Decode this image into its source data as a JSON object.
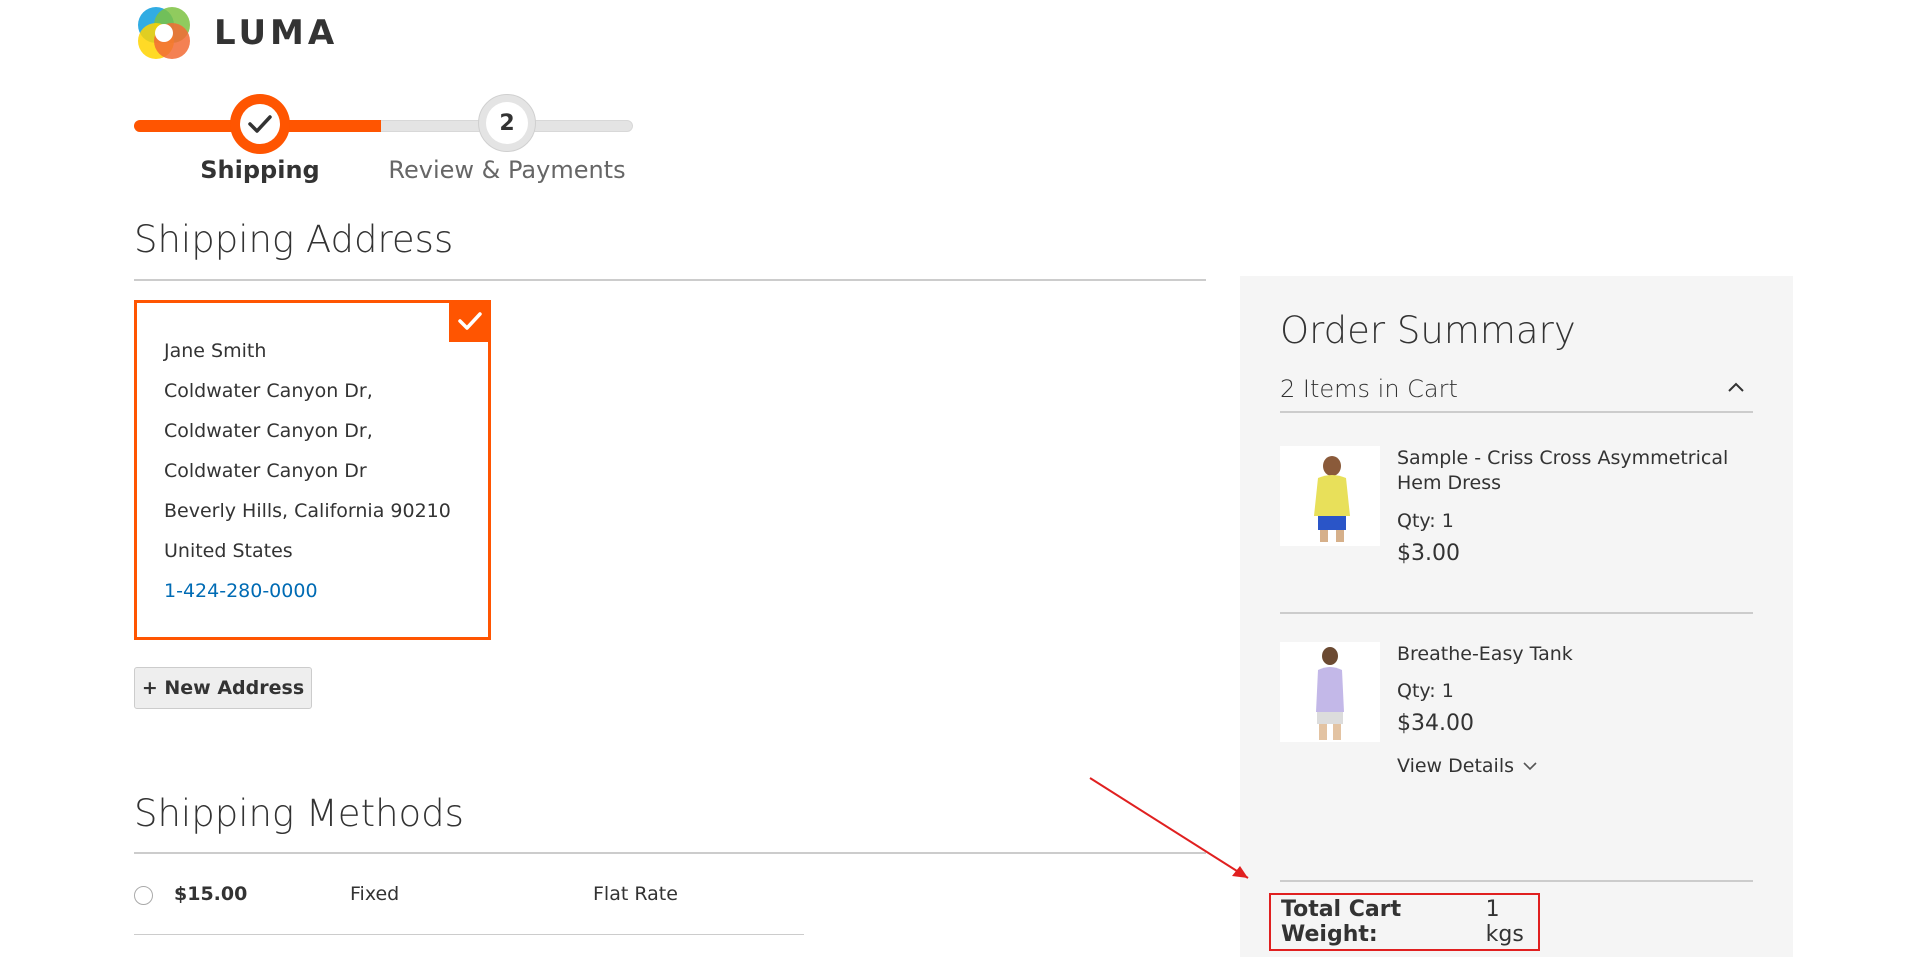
{
  "brand": {
    "name": "LUMA"
  },
  "progress": {
    "steps": [
      {
        "label": "Shipping",
        "state": "complete"
      },
      {
        "label": "Review & Payments",
        "number": "2",
        "state": "pending"
      }
    ]
  },
  "shipping_address": {
    "title": "Shipping Address",
    "selected_address": {
      "lines": [
        "Jane Smith",
        "Coldwater Canyon Dr,",
        "Coldwater Canyon Dr,",
        "Coldwater Canyon Dr",
        "Beverly Hills, California 90210",
        "United States"
      ],
      "phone": "1-424-280-0000"
    },
    "new_address_button": "+ New Address"
  },
  "shipping_methods": {
    "title": "Shipping Methods",
    "rows": [
      {
        "price": "$15.00",
        "type": "Fixed",
        "carrier": "Flat Rate"
      }
    ]
  },
  "order_summary": {
    "title": "Order Summary",
    "items_in_cart": "2 Items in Cart",
    "items": [
      {
        "name": "Sample - Criss Cross Asymmetrical Hem Dress",
        "qty": "Qty: 1",
        "price": "$3.00"
      },
      {
        "name": "Breathe-Easy Tank",
        "qty": "Qty: 1",
        "price": "$34.00",
        "view_details": "View Details"
      }
    ],
    "total_weight_label": "Total Cart Weight:",
    "total_weight_value": "1 kgs"
  },
  "colors": {
    "accent": "#ff5501",
    "link": "#006bb4",
    "annotation": "#e02020"
  }
}
